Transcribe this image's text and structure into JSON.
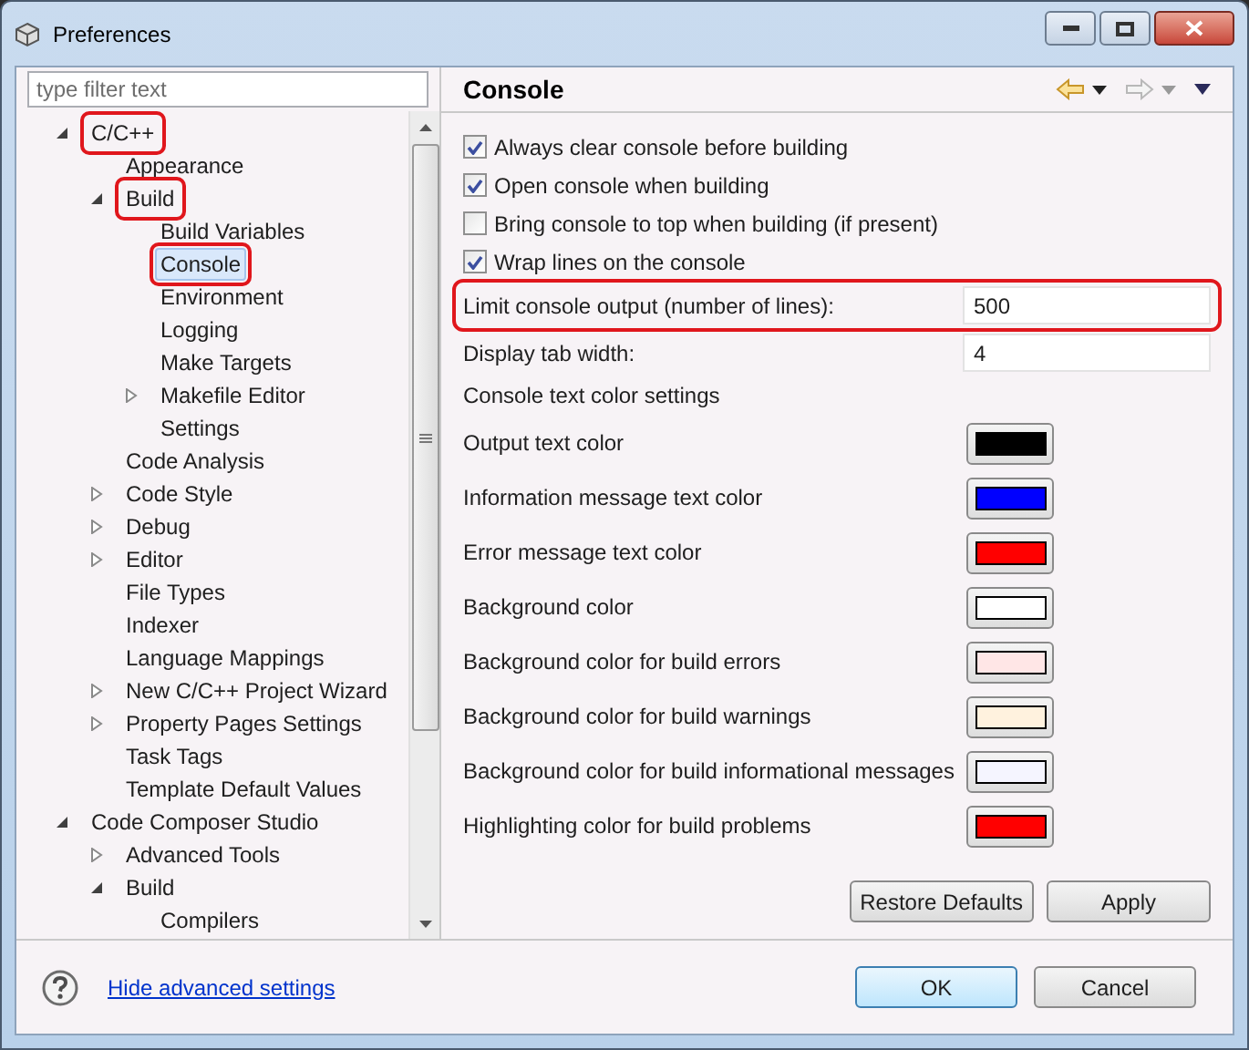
{
  "window": {
    "title": "Preferences"
  },
  "filter": {
    "placeholder": "type filter text"
  },
  "tree": [
    {
      "label": "C/C++",
      "expanded": true,
      "selected": false,
      "highlighted": true,
      "children": [
        {
          "label": "Appearance",
          "selected": false,
          "highlighted": false
        },
        {
          "label": "Build",
          "expanded": true,
          "selected": false,
          "highlighted": true,
          "children": [
            {
              "label": "Build Variables",
              "selected": false,
              "highlighted": false
            },
            {
              "label": "Console",
              "selected": true,
              "highlighted": true
            },
            {
              "label": "Environment",
              "selected": false,
              "highlighted": false
            },
            {
              "label": "Logging",
              "selected": false,
              "highlighted": false
            },
            {
              "label": "Make Targets",
              "selected": false,
              "highlighted": false
            },
            {
              "label": "Makefile Editor",
              "expanded": false,
              "selected": false,
              "highlighted": false
            },
            {
              "label": "Settings",
              "selected": false,
              "highlighted": false
            }
          ]
        },
        {
          "label": "Code Analysis",
          "selected": false,
          "highlighted": false
        },
        {
          "label": "Code Style",
          "expanded": false,
          "selected": false,
          "highlighted": false
        },
        {
          "label": "Debug",
          "expanded": false,
          "selected": false,
          "highlighted": false
        },
        {
          "label": "Editor",
          "expanded": false,
          "selected": false,
          "highlighted": false
        },
        {
          "label": "File Types",
          "selected": false,
          "highlighted": false
        },
        {
          "label": "Indexer",
          "selected": false,
          "highlighted": false
        },
        {
          "label": "Language Mappings",
          "selected": false,
          "highlighted": false
        },
        {
          "label": "New C/C++ Project Wizard",
          "expanded": false,
          "selected": false,
          "highlighted": false
        },
        {
          "label": "Property Pages Settings",
          "expanded": false,
          "selected": false,
          "highlighted": false
        },
        {
          "label": "Task Tags",
          "selected": false,
          "highlighted": false
        },
        {
          "label": "Template Default Values",
          "selected": false,
          "highlighted": false
        }
      ]
    },
    {
      "label": "Code Composer Studio",
      "expanded": true,
      "selected": false,
      "highlighted": false,
      "children": [
        {
          "label": "Advanced Tools",
          "expanded": false,
          "selected": false,
          "highlighted": false
        },
        {
          "label": "Build",
          "expanded": true,
          "selected": false,
          "highlighted": false,
          "children": [
            {
              "label": "Compilers",
              "selected": false,
              "highlighted": false
            }
          ]
        }
      ]
    }
  ],
  "page": {
    "title": "Console",
    "checkboxes": [
      {
        "label": "Always clear console before building",
        "checked": true
      },
      {
        "label": "Open console when building",
        "checked": true
      },
      {
        "label": "Bring console to top when building (if present)",
        "checked": false
      },
      {
        "label": "Wrap lines on the console",
        "checked": true
      }
    ],
    "fields": [
      {
        "label": "Limit console output (number of lines):",
        "value": "500",
        "highlighted": true
      },
      {
        "label": "Display tab width:",
        "value": "4",
        "highlighted": false
      }
    ],
    "color_heading": "Console text color settings",
    "colors": [
      {
        "label": "Output text color",
        "color": "#000000"
      },
      {
        "label": "Information message text color",
        "color": "#0000ff"
      },
      {
        "label": "Error message text color",
        "color": "#ff0000"
      },
      {
        "label": "Background color",
        "color": "#ffffff"
      },
      {
        "label": "Background color for build errors",
        "color": "#ffe6e6"
      },
      {
        "label": "Background color for build warnings",
        "color": "#fff2de"
      },
      {
        "label": "Background color for build informational messages",
        "color": "#f5f5ff"
      },
      {
        "label": "Highlighting color for build problems",
        "color": "#ff0000"
      }
    ],
    "buttons": [
      "Restore Defaults",
      "Apply"
    ]
  },
  "footer": {
    "link": "Hide advanced settings",
    "buttons": [
      "OK",
      "Cancel"
    ]
  }
}
